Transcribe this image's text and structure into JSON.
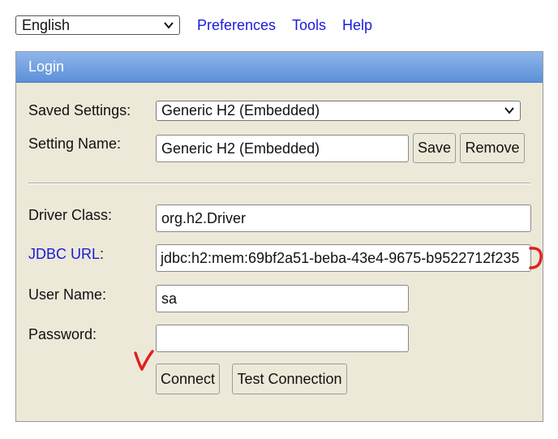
{
  "language_select": {
    "value": "English",
    "icon": "chevron-down-icon"
  },
  "top_links": [
    {
      "label": "Preferences"
    },
    {
      "label": "Tools"
    },
    {
      "label": "Help"
    }
  ],
  "panel": {
    "title": "Login"
  },
  "saved_settings": {
    "label": "Saved Settings:",
    "value": "Generic H2 (Embedded)",
    "icon": "chevron-down-icon"
  },
  "setting_name": {
    "label": "Setting Name:",
    "value": "Generic H2 (Embedded)",
    "save_label": "Save",
    "remove_label": "Remove"
  },
  "driver_class": {
    "label": "Driver Class:",
    "value": "org.h2.Driver"
  },
  "jdbc_url": {
    "label": "JDBC URL",
    "suffix": ":",
    "value": "jdbc:h2:mem:69bf2a51-beba-43e4-9675-b9522712f235"
  },
  "user_name": {
    "label": "User Name:",
    "value": "sa"
  },
  "password": {
    "label": "Password:",
    "value": ""
  },
  "actions": {
    "connect_label": "Connect",
    "test_label": "Test Connection"
  },
  "annotations": {
    "color": "#e0201e"
  }
}
